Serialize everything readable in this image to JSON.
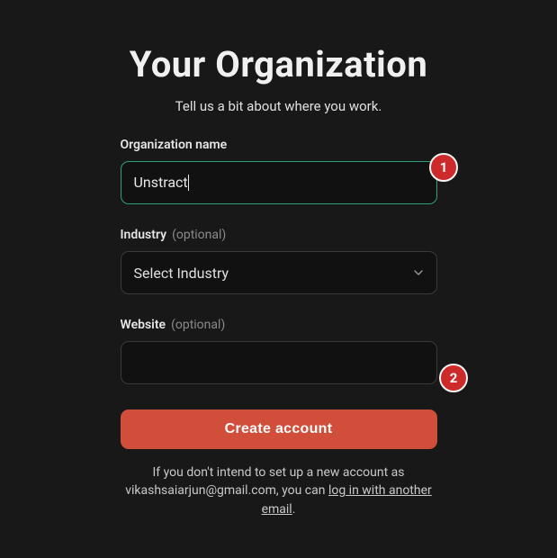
{
  "header": {
    "title": "Your Organization",
    "subtitle": "Tell us a bit about where you work."
  },
  "org_name": {
    "label": "Organization name",
    "value": "Unstract"
  },
  "industry": {
    "label": "Industry",
    "optional": "(optional)",
    "placeholder": "Select Industry"
  },
  "website": {
    "label": "Website",
    "optional": "(optional)",
    "value": ""
  },
  "submit": {
    "label": "Create account"
  },
  "help": {
    "prefix": "If you don't intend to set up a new account as ",
    "email": "vikashsaiarjun@gmail.com",
    "middle": ", you can ",
    "link": "log in with another email",
    "suffix": "."
  },
  "annotations": {
    "a1": "1",
    "a2": "2"
  }
}
